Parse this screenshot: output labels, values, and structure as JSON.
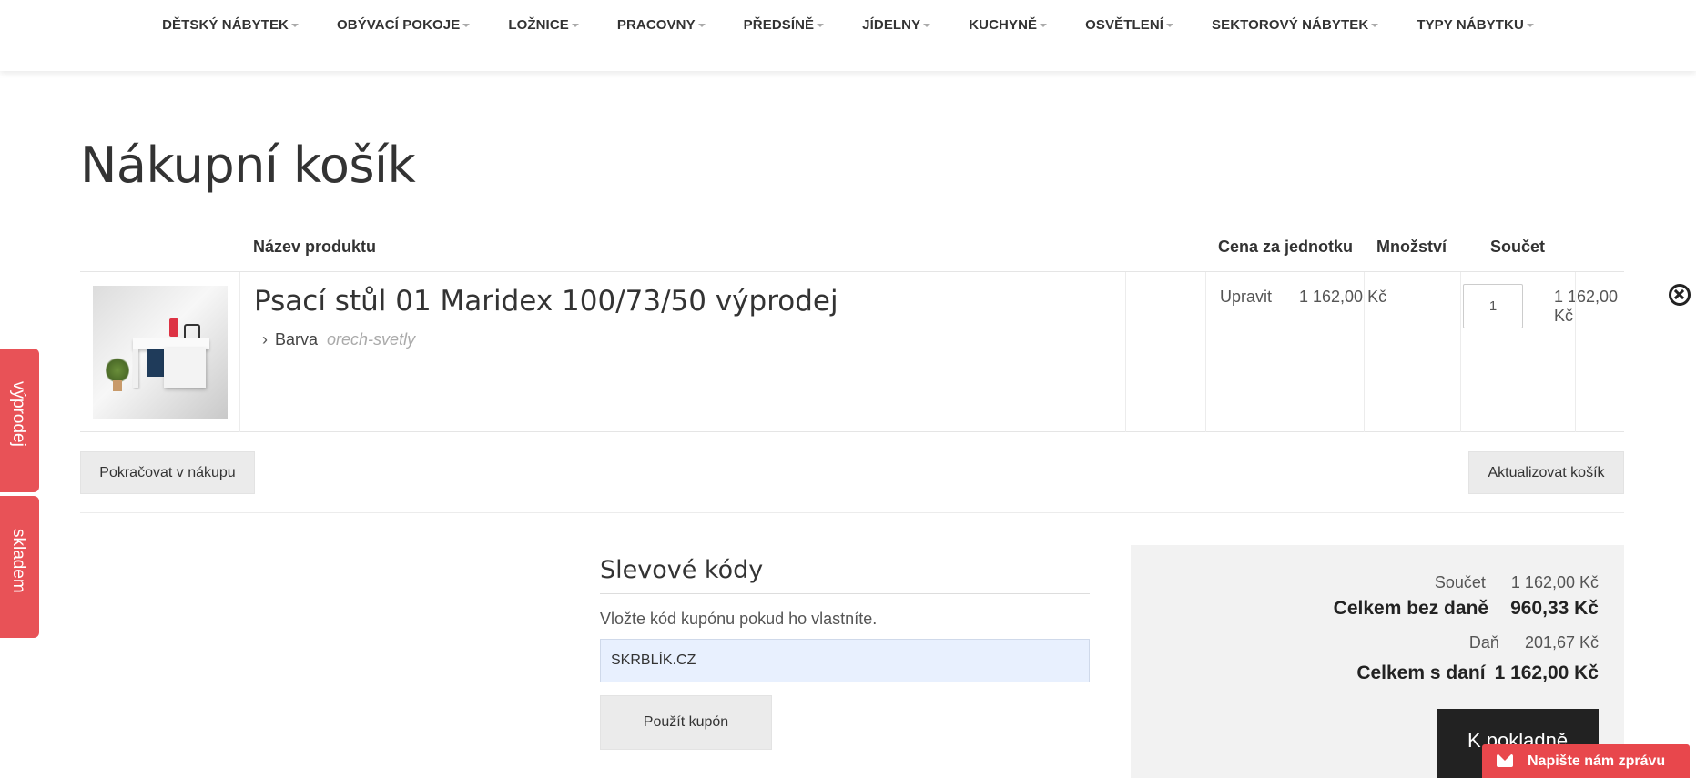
{
  "nav": {
    "items": [
      {
        "label": "DĚTSKÝ NÁBYTEK"
      },
      {
        "label": "OBÝVACÍ POKOJE"
      },
      {
        "label": "LOŽNICE"
      },
      {
        "label": "PRACOVNY"
      },
      {
        "label": "PŘEDSÍNĚ"
      },
      {
        "label": "JÍDELNY"
      },
      {
        "label": "KUCHYNĚ"
      },
      {
        "label": "OSVĚTLENÍ"
      },
      {
        "label": "SEKTOROVÝ NÁBYTEK"
      },
      {
        "label": "TYPY NÁBYTKU"
      }
    ]
  },
  "page": {
    "title": "Nákupní košík"
  },
  "table": {
    "headers": {
      "product": "Název produktu",
      "unit_price": "Cena za jednotku",
      "quantity": "Množství",
      "total": "Součet"
    },
    "rows": [
      {
        "name": "Psací stůl 01 Maridex 100/73/50 výprodej",
        "option_label": "Barva",
        "option_value": "orech-svetly",
        "edit_label": "Upravit",
        "unit_price": "1 162,00 Kč",
        "quantity": "1",
        "total": "1 162,00 Kč"
      }
    ]
  },
  "actions": {
    "continue_label": "Pokračovat v nákupu",
    "update_label": "Aktualizovat košík"
  },
  "discount": {
    "title": "Slevové kódy",
    "description": "Vložte kód kupónu pokud ho vlastníte.",
    "code_value": "SKRBLÍK.CZ",
    "apply_label": "Použít kupón"
  },
  "summary": {
    "subtotal_label": "Součet",
    "subtotal_value": "1 162,00 Kč",
    "net_label": "Celkem bez daně",
    "net_value": "960,33 Kč",
    "tax_label": "Daň",
    "tax_value": "201,67 Kč",
    "grand_label": "Celkem s daní",
    "grand_value": "1 162,00 Kč",
    "checkout_label": "K pokladně"
  },
  "side_tabs": {
    "sale": "výprodej",
    "stock": "skladem"
  },
  "chat": {
    "label": "Napište nám zprávu"
  },
  "colors": {
    "accent_red": "#e85257",
    "checkout_dark": "#222222",
    "coupon_fill": "#e8f0fe"
  }
}
